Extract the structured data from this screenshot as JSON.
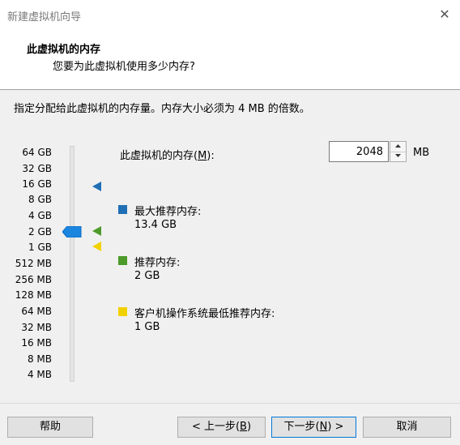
{
  "window": {
    "title": "新建虚拟机向导",
    "close_label": "✕"
  },
  "header": {
    "title": "此虚拟机的内存",
    "subtitle": "您要为此虚拟机使用多少内存?"
  },
  "instruction": "指定分配给此虚拟机的内存量。内存大小必须为 4 MB 的倍数。",
  "scale": {
    "labels": [
      "64 GB",
      "32 GB",
      "16 GB",
      "8 GB",
      "4 GB",
      "2 GB",
      "1 GB",
      "512 MB",
      "256 MB",
      "128 MB",
      "64 MB",
      "32 MB",
      "16 MB",
      "8 MB",
      "4 MB"
    ],
    "selected_label": "2 GB"
  },
  "memory": {
    "label_prefix": "此虚拟机的内存(",
    "label_key": "M",
    "label_suffix": "):",
    "value": "2048",
    "unit": "MB"
  },
  "legend": {
    "max": {
      "label": "最大推荐内存:",
      "value": "13.4 GB",
      "color": "#1f6fb5"
    },
    "recommended": {
      "label": "推荐内存:",
      "value": "2 GB",
      "color": "#4c9a2a"
    },
    "min": {
      "label": "客户机操作系统最低推荐内存:",
      "value": "1 GB",
      "color": "#f2d100"
    }
  },
  "buttons": {
    "help": "帮助",
    "back_prefix": "< 上一步(",
    "back_key": "B",
    "back_suffix": ")",
    "next_prefix": "下一步(",
    "next_key": "N",
    "next_suffix": ") >",
    "cancel": "取消"
  }
}
